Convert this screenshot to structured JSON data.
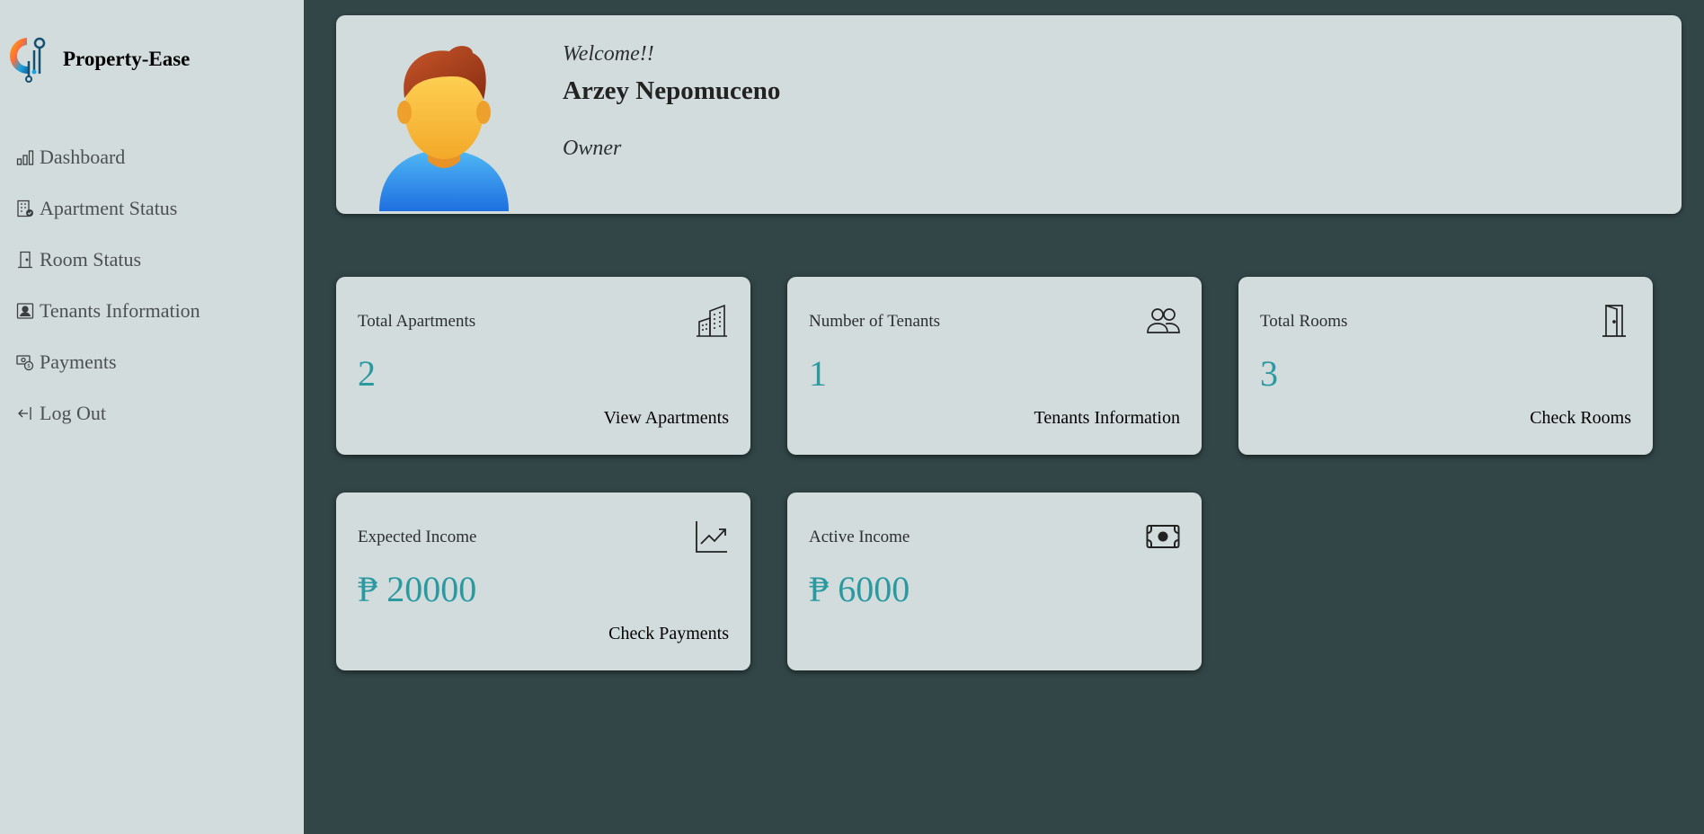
{
  "brand": {
    "name": "Property-Ease",
    "logo_icon": "property-ease-logo"
  },
  "sidebar": {
    "items": [
      {
        "label": "Dashboard",
        "icon": "bar-chart-icon"
      },
      {
        "label": "Apartment Status",
        "icon": "building-check-icon"
      },
      {
        "label": "Room Status",
        "icon": "door-icon"
      },
      {
        "label": "Tenants Information",
        "icon": "person-badge-icon"
      },
      {
        "label": "Payments",
        "icon": "cash-coin-icon"
      },
      {
        "label": "Log Out",
        "icon": "logout-arrow-icon"
      }
    ]
  },
  "profile": {
    "welcome": "Welcome!!",
    "name": "Arzey Nepomuceno",
    "role": "Owner",
    "avatar_icon": "user-avatar"
  },
  "stats": [
    {
      "label": "Total Apartments",
      "value": "2",
      "link": "View Apartments",
      "icon": "buildings-icon"
    },
    {
      "label": "Number of Tenants",
      "value": "1",
      "link": "Tenants Information",
      "icon": "people-icon"
    },
    {
      "label": "Total Rooms",
      "value": "3",
      "link": "Check Rooms",
      "icon": "door-icon"
    },
    {
      "label": "Expected Income",
      "value": "₱ 20000",
      "link": "Check Payments",
      "icon": "graph-up-icon"
    },
    {
      "label": "Active Income",
      "value": "₱ 6000",
      "link": "",
      "icon": "cash-icon"
    }
  ],
  "colors": {
    "background": "#324648",
    "panel": "#d3dcdd",
    "accent": "#2a9aa0"
  }
}
